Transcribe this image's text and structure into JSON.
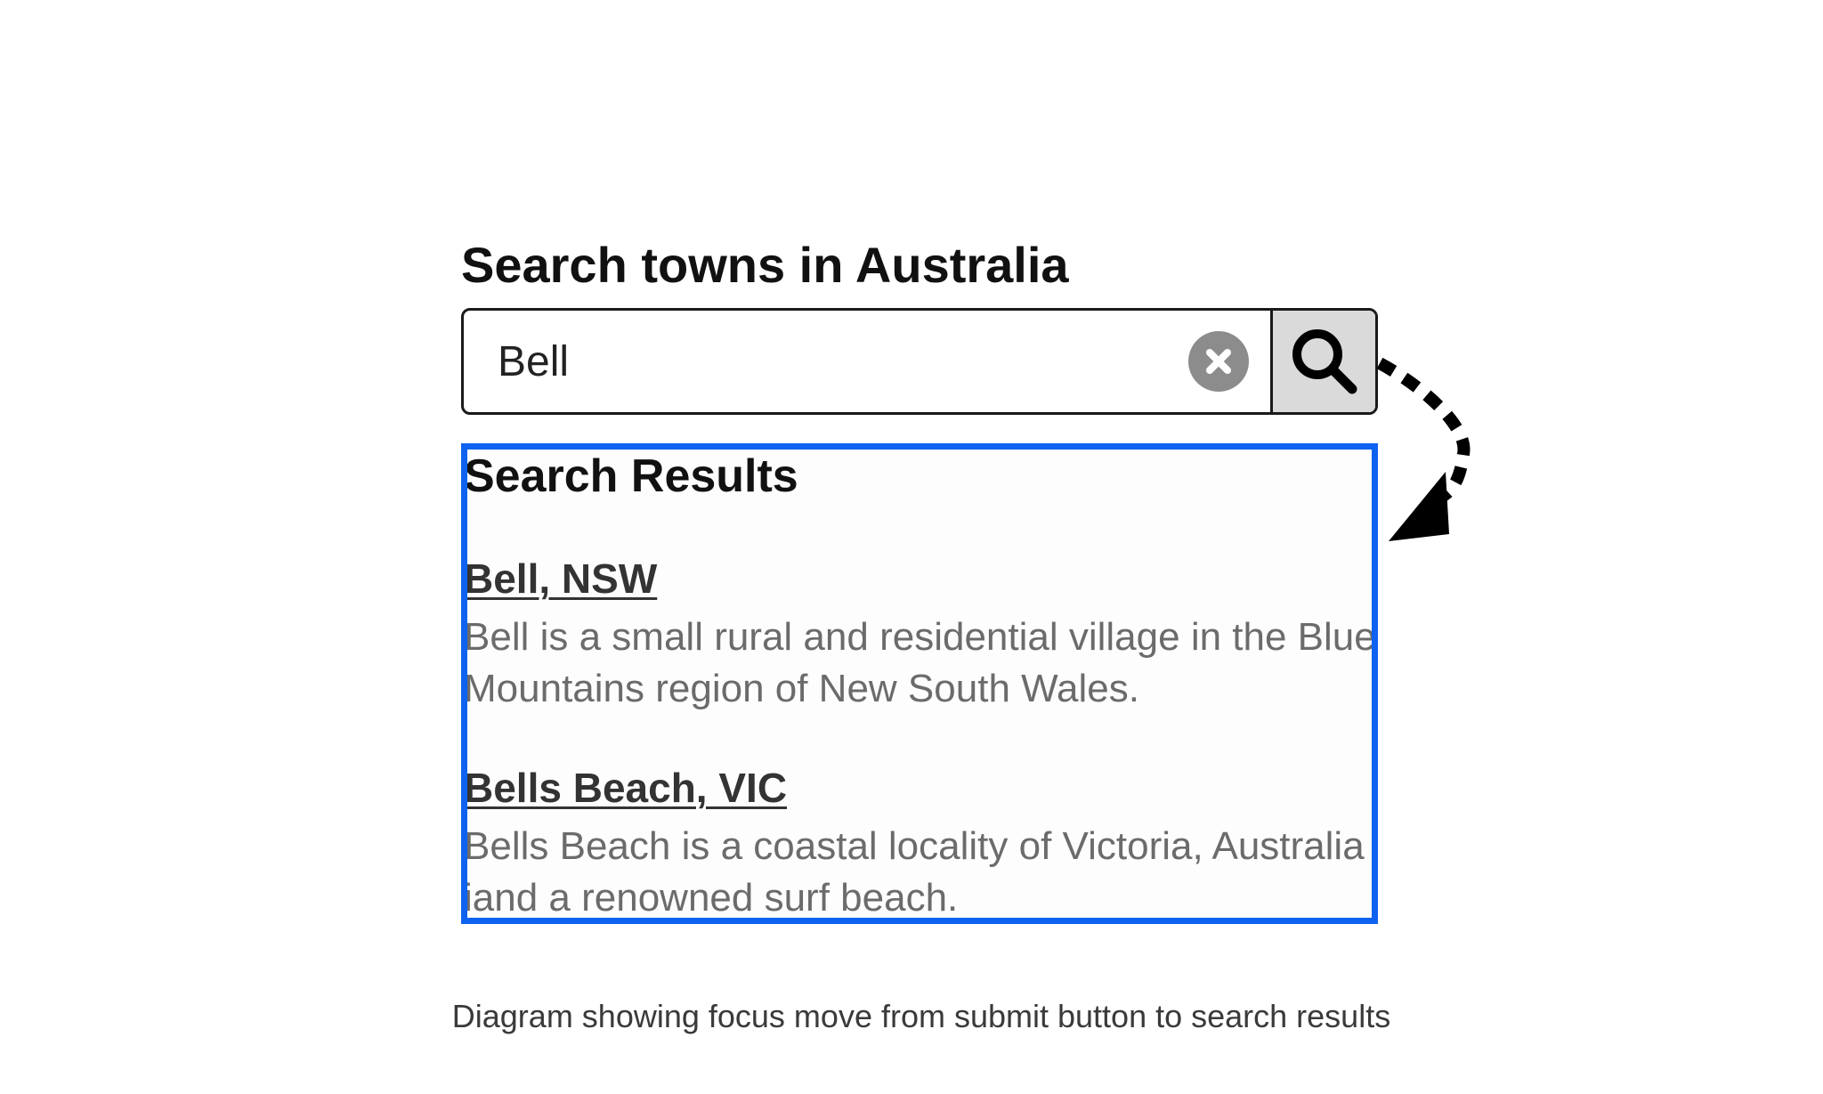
{
  "search": {
    "heading": "Search towns in Australia",
    "value": "Bell"
  },
  "icons": {
    "clear": "clear-x-circle-icon",
    "submit": "magnifying-glass-icon",
    "focus_arrow": "dotted-curved-arrow-icon"
  },
  "results": {
    "heading": "Search Results",
    "items": [
      {
        "title": "Bell, NSW",
        "description": "Bell is a small rural and residential village in the Blue Mountains region of New South Wales."
      },
      {
        "title": "Bells Beach, VIC",
        "description": "Bells Beach is a coastal locality of Victoria, Australia iand a renowned surf beach."
      }
    ]
  },
  "caption": "Diagram showing focus move from submit button to search results",
  "colors": {
    "focus_ring": "#0f62f0",
    "submit_background": "#dadada",
    "clear_icon": "#8c8c8c",
    "description_text": "#6b6b6b"
  }
}
